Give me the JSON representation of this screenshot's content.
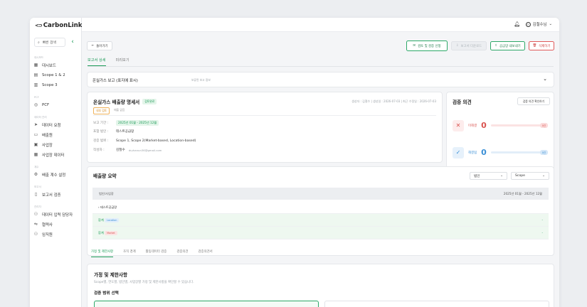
{
  "app": {
    "logo_mark": "<⊃",
    "logo_text": "CarbonLink"
  },
  "search": {
    "label": "빠른 검색"
  },
  "sidebar": {
    "sections": {
      "dashboard": "대시보드",
      "ghg": "PCF",
      "data": "데이터 관리",
      "settings": "계수",
      "report": "보고서",
      "admin": "관리자"
    },
    "items": [
      {
        "label": "대시보드",
        "icon": "▦"
      },
      {
        "label": "Scope 1 & 2",
        "icon": "▤"
      },
      {
        "label": "Scope 3",
        "icon": "▥"
      },
      {
        "label": "PCF",
        "icon": "◎"
      },
      {
        "label": "데이터 요청",
        "icon": "➤"
      },
      {
        "label": "배출원",
        "icon": "▭"
      },
      {
        "label": "사업장",
        "icon": "▣"
      },
      {
        "label": "사업장 데이터",
        "icon": "▦"
      },
      {
        "label": "배출 계수 설정",
        "icon": "⚙"
      },
      {
        "label": "보고서 검증",
        "icon": "▯"
      },
      {
        "label": "데이터 입력 담당자",
        "icon": "⚇"
      },
      {
        "label": "협력사",
        "icon": "⇋"
      },
      {
        "label": "임직원",
        "icon": "⚇"
      }
    ]
  },
  "topbar": {
    "user_name": "김철수님"
  },
  "toolbar": {
    "back": "돌아가기",
    "verify_request": "검토 및 검증 신청",
    "report_download": "보고서 다운로드",
    "share": "공급망 내보내기",
    "delete": "삭제하기"
  },
  "tabs": [
    "보고서 상세",
    "미리보기"
  ],
  "report_log": {
    "title": "온실가스 보고 (표지에 표시)",
    "hint": "보류된 보고 정보"
  },
  "report": {
    "title": "온실가스 배출량 명세서",
    "status": "검토완료",
    "meta": "생성자 : 김철수 | 생성일 : 2026-07-03 | 최근 수정일 : 2026-07-03",
    "tags": [
      "내부 검토",
      "배출 없음"
    ],
    "fields": [
      {
        "key": "보고 기간 :",
        "value": "2025년 01월 - 2025년 12월"
      },
      {
        "key": "포함 법인 :",
        "value": "테스트공급망"
      },
      {
        "key": "검증 범위 :",
        "value": "Scope 1, Scope 2(Market-based, Location-based)"
      },
      {
        "key": "작성자 :",
        "value": "김철수",
        "sub": "dryhanun36@gmail.com"
      }
    ]
  },
  "opinion": {
    "title": "검증 의견",
    "button": "검증 의견 확인하기",
    "rows": [
      {
        "label": "미해결",
        "count": "0",
        "tag": "0건",
        "color": "#d9534f"
      },
      {
        "label": "해결됨",
        "count": "0",
        "tag": "0건",
        "color": "#3a8fd6"
      }
    ]
  },
  "summary": {
    "title": "배출량 요약",
    "select1": "법인",
    "select2": "Scope",
    "col1": "법인/사업장",
    "col2": "2025년 01월 - 2025년 12월",
    "rows": [
      {
        "label": "테스트공급망",
        "value": ""
      },
      {
        "label": "합계",
        "tag": "Location",
        "value": "-"
      },
      {
        "label": "합계",
        "tag": "Market",
        "value": "-"
      }
    ]
  },
  "bottom_tabs": [
    "가정 및 제한사항",
    "조직 경계",
    "활동데이터 검증",
    "검증의견",
    "검증의견서"
  ],
  "assumptions": {
    "title": "가정 및 제한사항",
    "subtitle": "Scope별, 연도별, 법인별, 사업장별 가정 및 제한사항을 확인할 수 있습니다.",
    "scope_title": "검증 범위 선택"
  }
}
